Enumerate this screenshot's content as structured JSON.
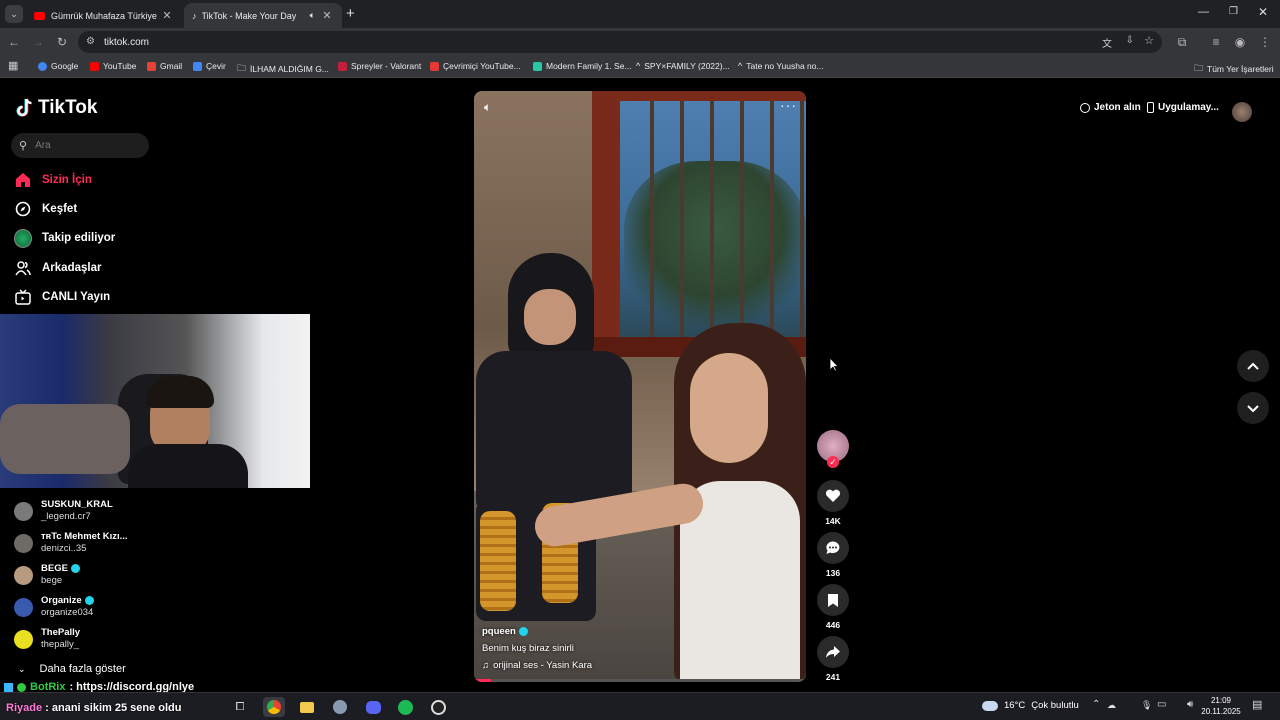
{
  "browser": {
    "tabs": [
      {
        "title": "Gümrük Muhafaza Türkiye 24.",
        "active": false
      },
      {
        "title": "TikTok - Make Your Day",
        "active": true
      }
    ],
    "url": "tiktok.com",
    "bookmarks": [
      {
        "label": "Google",
        "color": "#4285f4"
      },
      {
        "label": "YouTube",
        "color": "#ff0000"
      },
      {
        "label": "Gmail",
        "color": "#ea4335"
      },
      {
        "label": "Çevir",
        "color": "#4285f4"
      },
      {
        "label": "İLHAM ALDIĞIM G...",
        "color": "#9aa0a6"
      },
      {
        "label": "Spreyler - Valorant",
        "color": "#c41e3a"
      },
      {
        "label": "Çevrimiçi YouTube...",
        "color": "#e53935"
      },
      {
        "label": "Modern Family 1. Se...",
        "color": "#26c6a6"
      },
      {
        "label": "SPY×FAMILY (2022)...",
        "color": "#9aa0a6"
      },
      {
        "label": "Tate no Yuusha no...",
        "color": "#9aa0a6"
      }
    ],
    "all_bookmarks": "Tüm Yer İşaretleri"
  },
  "tiktok": {
    "logo": "TikTok",
    "search_placeholder": "Ara",
    "nav": [
      {
        "label": "Sizin İçin",
        "icon": "home-icon",
        "active": true
      },
      {
        "label": "Keşfet",
        "icon": "compass-icon",
        "active": false
      },
      {
        "label": "Takip ediliyor",
        "icon": "following-icon",
        "active": false
      },
      {
        "label": "Arkadaşlar",
        "icon": "friends-icon",
        "active": false
      },
      {
        "label": "CANLI Yayın",
        "icon": "live-icon",
        "active": false
      }
    ],
    "following": [
      {
        "name": "SUSKUN_KRAL",
        "username": "_legend.cr7",
        "verified": false
      },
      {
        "name": "ᴛʀTc Mehmet Kızı...",
        "username": "denizci..35",
        "verified": false
      },
      {
        "name": "BEGE",
        "username": "bege",
        "verified": true
      },
      {
        "name": "Organize",
        "username": "organize034",
        "verified": true
      },
      {
        "name": "ThePally",
        "username": "thepally_",
        "verified": false
      }
    ],
    "show_more": "Daha fazla göster",
    "top_right": {
      "coins": "Jeton alın",
      "app": "Uygulamay..."
    },
    "video": {
      "author": "pqueen",
      "author_verified": true,
      "caption": "Benim kuş biraz sinirli",
      "sound": "orijinal ses - Yasin Kara"
    },
    "actions": {
      "likes": "14K",
      "comments": "136",
      "saves": "446",
      "shares": "241"
    }
  },
  "chat_overlay": {
    "line1_user": "BotRix",
    "line1_text": ": https://discord.gg/nlye",
    "line2_user": "Riyade",
    "line2_text": ": anani sikim 25 sene oldu"
  },
  "taskbar": {
    "weather_temp": "16°C",
    "weather_desc": "Çok bulutlu",
    "time": "21:09",
    "date": "20.11.2025"
  }
}
